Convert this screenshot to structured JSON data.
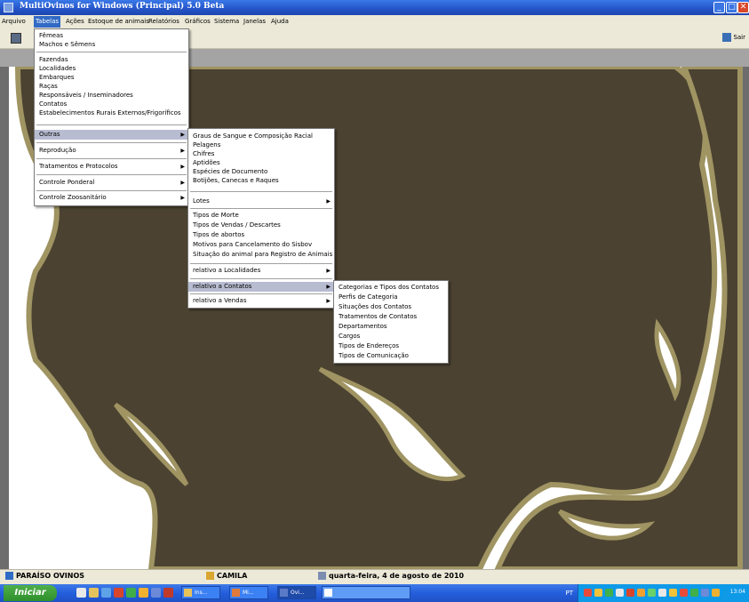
{
  "window": {
    "title": "MultiOvinos for Windows (Principal) 5.0 Beta",
    "controls": {
      "minimize": "_",
      "maximize": "□",
      "close": "✕"
    }
  },
  "menubar": [
    "Arquivo",
    "Tabelas",
    "Ações",
    "Estoque de animais",
    "Relatórios",
    "Gráficos",
    "Sistema",
    "Janelas",
    "Ajuda"
  ],
  "toolbar": {
    "exit_label": "Sair"
  },
  "menus": {
    "tabelas": {
      "group1": [
        "Fêmeas",
        "Machos e Sêmens"
      ],
      "group2": [
        "Fazendas",
        "Localidades",
        "Embarques",
        "Raças",
        "Responsáveis / Inseminadores",
        "Contatos",
        "Estabelecimentos Rurais Externos/Frigoríficos"
      ],
      "outras": "Outras",
      "reproducao": "Reprodução",
      "tratamentos": "Tratamentos e Protocolos",
      "ponderal": "Controle Ponderal",
      "zoosanitario": "Controle Zoosanitário"
    },
    "outras": {
      "group1": [
        "Graus de Sangue e Composição Racial",
        "Pelagens",
        "Chifres",
        "Aptidões",
        "Espécies de Documento",
        "Botijões, Canecas e Raques"
      ],
      "lotes": "Lotes",
      "group2": [
        "Tipos de Morte",
        "Tipos de Vendas / Descartes",
        "Tipos de abortos",
        "Motivos para Cancelamento do Sisbov",
        "Situação do animal para Registro de Animais"
      ],
      "localidades": "relativo a Localidades",
      "contatos": "relativo a Contatos",
      "vendas": "relativo a Vendas"
    },
    "contatos": {
      "items": [
        "Categorias e Tipos dos Contatos",
        "Perfis de Categoria",
        "Situações dos Contatos",
        "Tratamentos de Contatos",
        "Departamentos",
        "Cargos",
        "Tipos de Endereços",
        "Tipos de Comunicação"
      ]
    },
    "submenu_arrow": "▶"
  },
  "statusbar": {
    "company": "PARAÍSO OVINOS",
    "user": "CAMILA",
    "date": "quarta-feira, 4 de agosto de 2010"
  },
  "taskbar": {
    "start_label": "Iniciar",
    "buttons": [
      "Ins...",
      "Mi...",
      "Ovi..."
    ],
    "language": "PT",
    "clock": "13:04"
  },
  "colors": {
    "titlebar": "#2454c7",
    "menu_highlight": "#b8bcd1",
    "wallpaper_shape": "#4b4231",
    "wallpaper_outline": "#9f9462",
    "taskbar": "#245edb",
    "start_button": "#2f8f2b"
  }
}
